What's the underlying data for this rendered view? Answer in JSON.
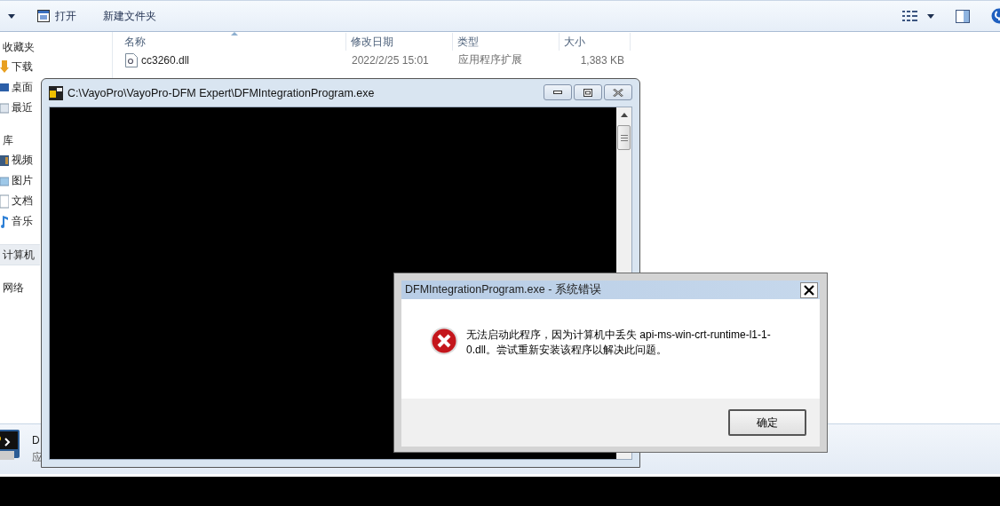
{
  "explorer": {
    "toolbar": {
      "buttons": [
        {
          "label": "打开"
        },
        {
          "label": "新建文件夹"
        }
      ]
    },
    "sidebar": {
      "sections": [
        {
          "label": "收藏夹",
          "selected": false,
          "children": [
            {
              "label": "下载",
              "selected": false
            },
            {
              "label": "桌面",
              "selected": false
            },
            {
              "label": "最近",
              "selected": false
            }
          ]
        },
        {
          "label": "库",
          "selected": false,
          "children": [
            {
              "label": "视频",
              "selected": false
            },
            {
              "label": "图片",
              "selected": false
            },
            {
              "label": "文档",
              "selected": false
            },
            {
              "label": "音乐",
              "selected": false
            }
          ]
        },
        {
          "label": "计算机",
          "selected": true
        },
        {
          "label": "网络",
          "selected": false
        }
      ]
    },
    "file_list": {
      "columns": [
        "名称",
        "修改日期",
        "类型",
        "大小"
      ],
      "rows": [
        {
          "name": "cc3260.dll",
          "modified": "2022/2/25 15:01",
          "type": "应用程序扩展",
          "size": "1,383 KB",
          "selected": false
        }
      ]
    },
    "details_pane": {
      "name": "D",
      "type": "应"
    }
  },
  "console_window": {
    "title": "C:\\VayoPro\\VayoPro-DFM Expert\\DFMIntegrationProgram.exe"
  },
  "error_dialog": {
    "title": "DFMIntegrationProgram.exe - 系统错误",
    "message": "无法启动此程序，因为计算机中丢失 api-ms-win-crt-runtime-l1-1-0.dll。尝试重新安装该程序以解决此问题。",
    "buttons": [
      {
        "label": "确定",
        "default": true
      }
    ]
  }
}
